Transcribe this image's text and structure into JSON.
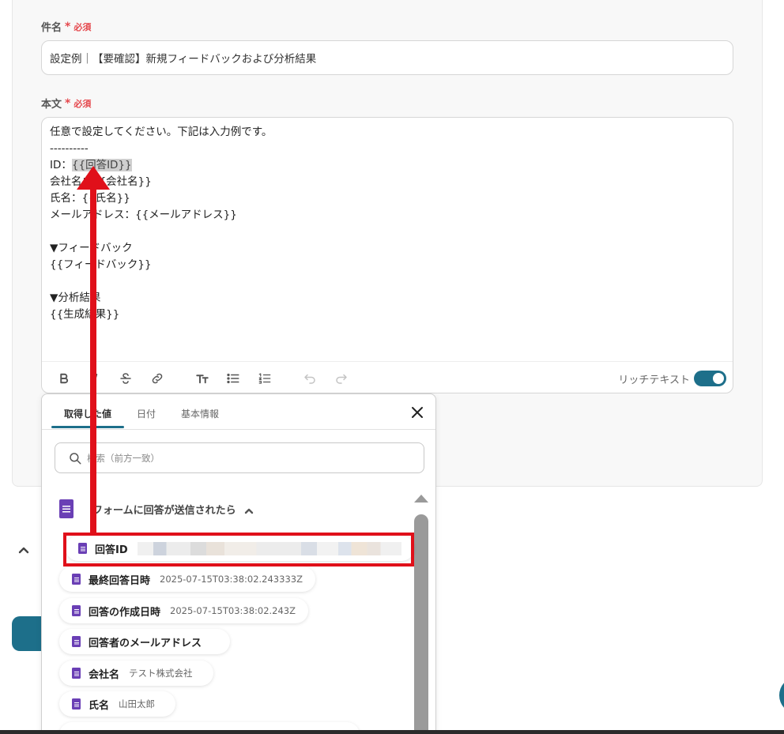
{
  "subject": {
    "label": "件名",
    "required_mark": "*",
    "required_text": "必須",
    "value": "設定例｜【要確認】新規フィードバックおよび分析結果"
  },
  "body": {
    "label": "本文",
    "required_mark": "*",
    "required_text": "必須",
    "lines": [
      "任意で設定してください。下記は入力例です。",
      "----------",
      "ID：",
      "会社名：{{会社名}}",
      "氏名：{{氏名}}",
      "メールアドレス：{{メールアドレス}}",
      "",
      "▼フィードバック",
      "{{フィードバック}}",
      "",
      "▼分析結果",
      "{{生成結果}}"
    ],
    "highlight_token": "{{回答ID}}"
  },
  "toolbar": {
    "rich_text_label": "リッチテキスト",
    "rich_text_enabled": true
  },
  "dropdown": {
    "tabs": [
      {
        "label": "取得した値",
        "active": true
      },
      {
        "label": "日付",
        "active": false
      },
      {
        "label": "基本情報",
        "active": false
      }
    ],
    "search_placeholder": "検索（前方一致）",
    "section_title": "フォームに回答が送信されたら",
    "items": [
      {
        "label": "回答ID",
        "value": ""
      },
      {
        "label": "最終回答日時",
        "value": "2025-07-15T03:38:02.243333Z"
      },
      {
        "label": "回答の作成日時",
        "value": "2025-07-15T03:38:02.243Z"
      },
      {
        "label": "回答者のメールアドレス",
        "value": ""
      },
      {
        "label": "会社名",
        "value": "テスト株式会社"
      },
      {
        "label": "氏名",
        "value": "山田太郎"
      }
    ]
  },
  "colors": {
    "accent": "#1d6f8a",
    "required": "#e5484d",
    "highlight_box": "#e0101a",
    "forms_icon": "#6a3fb5"
  }
}
